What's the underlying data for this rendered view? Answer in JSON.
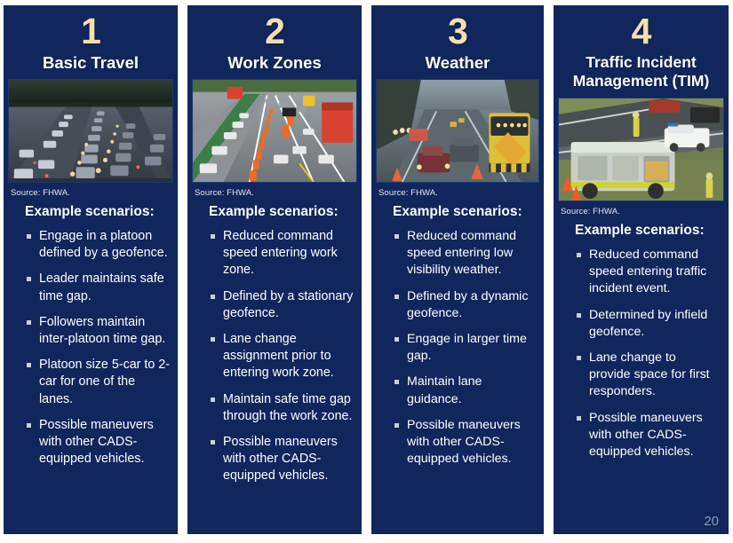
{
  "slide": {
    "page_number": "20",
    "source_label": "Source: FHWA.",
    "scenarios_heading": "Example scenarios:",
    "accent_number_color": "#f5dfb0",
    "panel_color": "#10265c",
    "text_color": "#ffffff"
  },
  "columns": [
    {
      "number": "1",
      "title": "Basic Travel",
      "image_alt": "freeway-congestion-photo",
      "source": "Source: FHWA.",
      "heading": "Example scenarios:",
      "bullets": [
        "Engage in a platoon defined by a geofence.",
        "Leader maintains safe time gap.",
        "Followers maintain inter-platoon time gap.",
        "Platoon size 5-car to 2-car for one of the lanes.",
        "Possible maneuvers with other CADS-equipped vehicles."
      ]
    },
    {
      "number": "2",
      "title": "Work Zones",
      "image_alt": "highway-work-zone-photo",
      "source": "Source: FHWA.",
      "heading": "Example scenarios:",
      "bullets": [
        "Reduced command speed entering work zone.",
        "Defined by a stationary geofence.",
        "Lane change assignment prior to entering work zone.",
        "Maintain safe time gap through the work zone.",
        "Possible maneuvers with other CADS-equipped vehicles."
      ]
    },
    {
      "number": "3",
      "title": "Weather",
      "image_alt": "rainy-low-visibility-road-photo",
      "source": "Source: FHWA.",
      "heading": "Example scenarios:",
      "bullets": [
        "Reduced command speed entering low visibility weather.",
        "Defined by a dynamic geofence.",
        "Engage in larger time gap.",
        "Maintain lane guidance.",
        "Possible maneuvers with other CADS-equipped vehicles."
      ]
    },
    {
      "number": "4",
      "title": "Traffic Incident Management (TIM)",
      "image_alt": "incident-response-fire-truck-photo",
      "source": "Source: FHWA.",
      "heading": "Example scenarios:",
      "bullets": [
        "Reduced command speed entering traffic incident event.",
        "Determined by infield geofence.",
        "Lane change to provide space for first responders.",
        "Possible maneuvers with other CADS-equipped vehicles."
      ]
    }
  ]
}
